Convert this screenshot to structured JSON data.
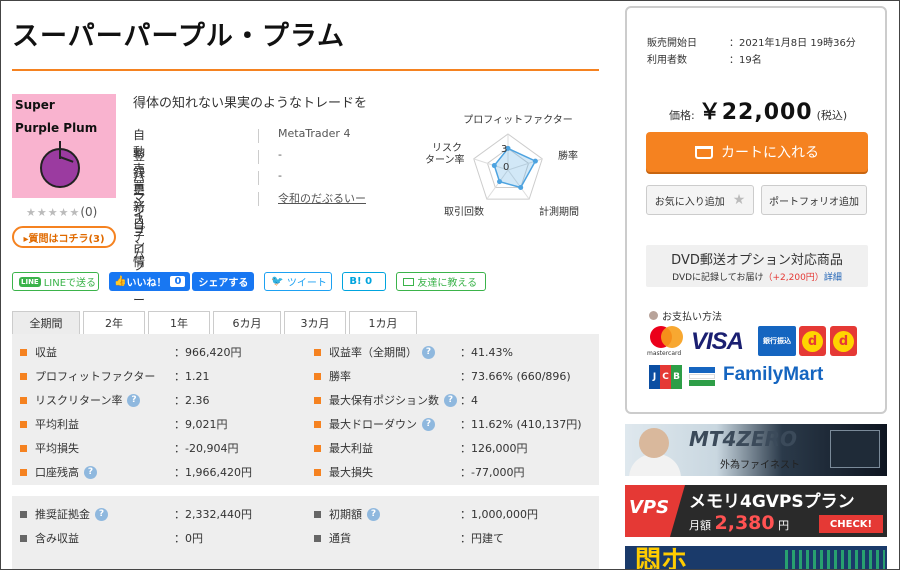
{
  "product": {
    "title": "スーパーパープル・プラム",
    "thumbnail_line1": "Super",
    "thumbnail_line2": "Purple Plum",
    "rating_stars": "★★★★★",
    "rating_count": "(0)",
    "question_button": "▸質問はコチラ(3)",
    "tagline": "得体の知れない果実のようなトレードを"
  },
  "info": [
    {
      "label": "自動売買システム",
      "value": "MetaTrader 4"
    },
    {
      "label": "登録更新日",
      "value": "-"
    },
    {
      "label": "バージョン情報",
      "value": "-"
    },
    {
      "label": "マイプロフィール",
      "value": "令和のだぶるいー"
    }
  ],
  "radar": {
    "labels": {
      "top": "プロフィットファクター",
      "right": "勝率",
      "bottom_right": "計測期間",
      "bottom_left": "取引回数",
      "left_line1": "リスク",
      "left_line2": "ターン率"
    },
    "ticks": [
      "3",
      "0"
    ],
    "values": [
      3,
      4,
      3,
      2,
      2
    ],
    "max": 5
  },
  "social": {
    "line": "LINEで送る",
    "line_icon": "LINE",
    "fb_like": "いいね！",
    "fb_count": "0",
    "fb_share": "シェアする",
    "tweet": "ツイート",
    "hatena": "B! 0",
    "friend": "友達に教える"
  },
  "tabs": [
    "全期間",
    "2年",
    "1年",
    "6カ月",
    "3カ月",
    "1カ月"
  ],
  "stats_left": [
    {
      "label": "収益",
      "value": "：966,420円",
      "help": false
    },
    {
      "label": "プロフィットファクター",
      "value": "：1.21",
      "help": false
    },
    {
      "label": "リスクリターン率",
      "value": "：2.36",
      "help": true
    },
    {
      "label": "平均利益",
      "value": "：9,021円",
      "help": false
    },
    {
      "label": "平均損失",
      "value": "：-20,904円",
      "help": false
    },
    {
      "label": "口座残高",
      "value": "：1,966,420円",
      "help": true
    }
  ],
  "stats_right": [
    {
      "label": "収益率（全期間）",
      "value": "：41.43%",
      "help": true
    },
    {
      "label": "勝率",
      "value": "：73.66% (660/896)",
      "help": false
    },
    {
      "label": "最大保有ポジション数",
      "value": "：4",
      "help": true
    },
    {
      "label": "最大ドローダウン",
      "value": "：11.62% (410,137円)",
      "help": true
    },
    {
      "label": "最大利益",
      "value": "：126,000円",
      "help": false
    },
    {
      "label": "最大損失",
      "value": "：-77,000円",
      "help": false
    }
  ],
  "stats2_left": [
    {
      "label": "推奨証拠金",
      "value": "：2,332,440円",
      "help": true
    },
    {
      "label": "含み収益",
      "value": "：0円",
      "help": false
    }
  ],
  "stats2_right": [
    {
      "label": "初期額",
      "value": "：1,000,000円",
      "help": true
    },
    {
      "label": "通貨",
      "value": "：円建て",
      "help": false
    }
  ],
  "sidebar": {
    "sale_start_label": "販売開始日",
    "sale_start_value": "：2021年1月8日 19時36分",
    "users_label": "利用者数",
    "users_value": "：19名",
    "price_label": "価格:",
    "price_value": "￥22,000",
    "price_tax": "(税込)",
    "cart_button": "カートに入れる",
    "fav_button": "お気に入り追加",
    "portfolio_button": "ポートフォリオ追加",
    "dvd_title": "DVD郵送オプション対応商品",
    "dvd_sub_prefix": "DVDに記録してお届け",
    "dvd_sub_price": "（+2,200円）",
    "dvd_link": "詳細",
    "payment_title": "お支払い方法",
    "mastercard_text": "mastercard",
    "visa_text": "VISA",
    "bank_text": "銀行振込",
    "dpay1": "d",
    "dpay2": "d",
    "jcb_text": [
      "J",
      "C",
      "B"
    ],
    "familymart_text": "FamilyMart"
  },
  "banners": {
    "mt4_title": "MT4ZERO",
    "mt4_sub": "外為ファイネスト",
    "vps_left": "VPS",
    "vps_title": "メモリ4GVPSプラン",
    "vps_price_prefix": "月額",
    "vps_price": "2,380",
    "vps_price_suffix": "円",
    "vps_check": "CHECK!",
    "ban3_text": "悶ホ"
  },
  "colors": {
    "accent": "#f58220",
    "stats_bg": "#eeeeee",
    "help_icon": "#8fb8de",
    "radar_fill": "#4da3e0"
  }
}
